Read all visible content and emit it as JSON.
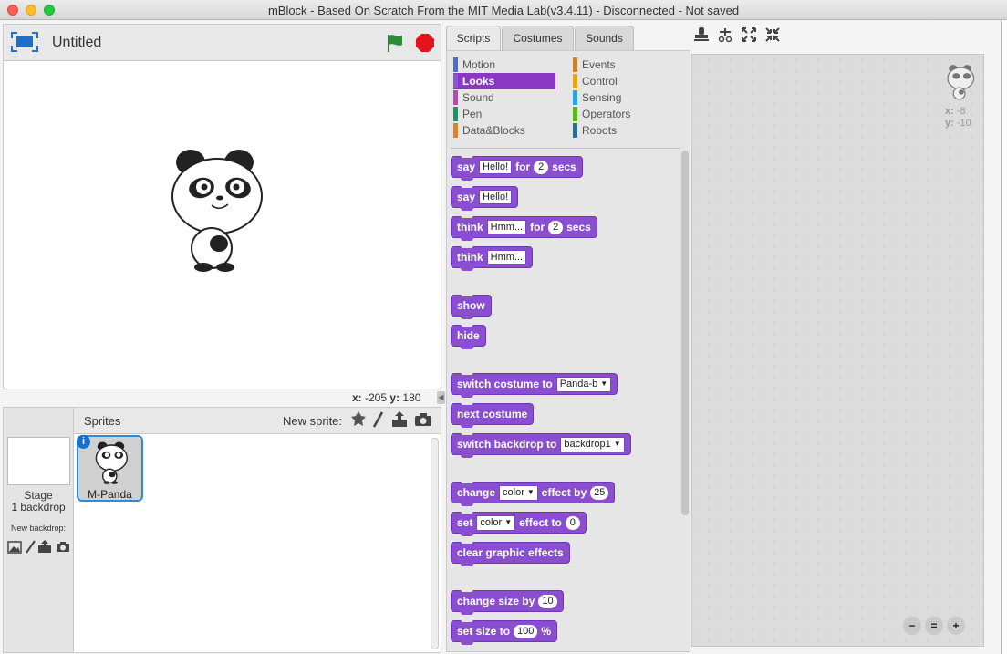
{
  "window": {
    "title": "mBlock - Based On Scratch From the MIT Media Lab(v3.4.11) - Disconnected - Not saved"
  },
  "stage": {
    "title": "Untitled",
    "x_label": "x:",
    "x_value": "-205",
    "y_label": "y:",
    "y_value": "180"
  },
  "sprites": {
    "header": "Sprites",
    "new_sprite_label": "New sprite:",
    "stage_label": "Stage",
    "backdrop_count": "1 backdrop",
    "new_backdrop_label": "New backdrop:",
    "items": [
      {
        "name": "M-Panda"
      }
    ]
  },
  "tabs": [
    {
      "label": "Scripts"
    },
    {
      "label": "Costumes"
    },
    {
      "label": "Sounds"
    }
  ],
  "categories": {
    "left": [
      {
        "label": "Motion",
        "color": "#4a6cd4"
      },
      {
        "label": "Looks",
        "color": "#8a55d7"
      },
      {
        "label": "Sound",
        "color": "#bb42c3"
      },
      {
        "label": "Pen",
        "color": "#0e9a6c"
      },
      {
        "label": "Data&Blocks",
        "color": "#ee7d16"
      }
    ],
    "right": [
      {
        "label": "Events",
        "color": "#c88330"
      },
      {
        "label": "Control",
        "color": "#e1a91a"
      },
      {
        "label": "Sensing",
        "color": "#2ca5e2"
      },
      {
        "label": "Operators",
        "color": "#5cb712"
      },
      {
        "label": "Robots",
        "color": "#2a6f8f"
      }
    ]
  },
  "blocks": {
    "say_for": {
      "kw1": "say",
      "val": "Hello!",
      "kw2": "for",
      "num": "2",
      "kw3": "secs"
    },
    "say": {
      "kw1": "say",
      "val": "Hello!"
    },
    "think_for": {
      "kw1": "think",
      "val": "Hmm...",
      "kw2": "for",
      "num": "2",
      "kw3": "secs"
    },
    "think": {
      "kw1": "think",
      "val": "Hmm..."
    },
    "show": "show",
    "hide": "hide",
    "switch_costume": {
      "kw": "switch costume to",
      "val": "Panda-b"
    },
    "next_costume": "next costume",
    "switch_backdrop": {
      "kw": "switch backdrop to",
      "val": "backdrop1"
    },
    "change_effect": {
      "kw1": "change",
      "val": "color",
      "kw2": "effect by",
      "num": "25"
    },
    "set_effect": {
      "kw1": "set",
      "val": "color",
      "kw2": "effect to",
      "num": "0"
    },
    "clear_effects": "clear graphic effects",
    "change_size": {
      "kw": "change size by",
      "num": "10"
    },
    "set_size": {
      "kw": "set size to",
      "num": "100",
      "unit": "%"
    }
  },
  "scripts_area": {
    "x_label": "x:",
    "x_value": "-8",
    "y_label": "y:",
    "y_value": "-10"
  },
  "zoom": {
    "out": "−",
    "reset": "=",
    "in": "+"
  },
  "colors": {
    "looks_block": "#8a4fd1",
    "selected_category": "#8a37c4",
    "sprite_selected_border": "#2e8bd6"
  }
}
